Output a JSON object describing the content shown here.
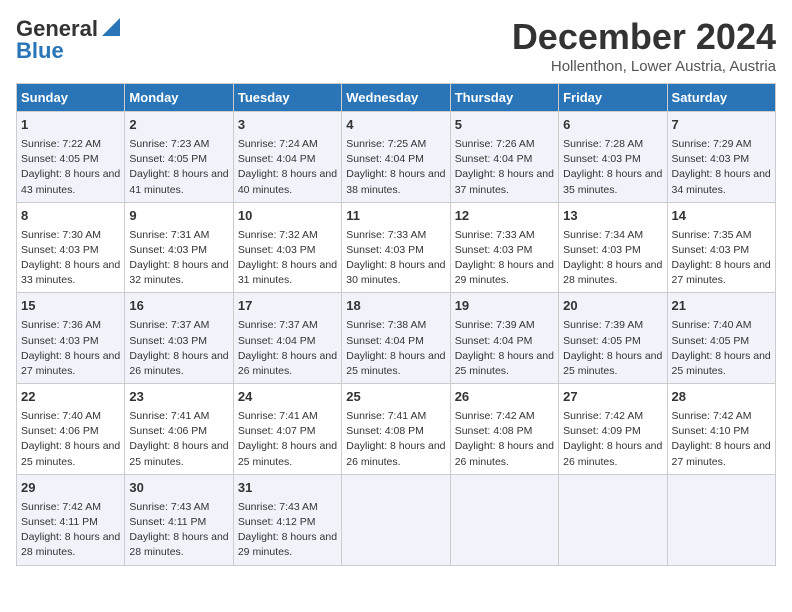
{
  "header": {
    "logo_general": "General",
    "logo_blue": "Blue",
    "month": "December 2024",
    "location": "Hollenthon, Lower Austria, Austria"
  },
  "weekdays": [
    "Sunday",
    "Monday",
    "Tuesday",
    "Wednesday",
    "Thursday",
    "Friday",
    "Saturday"
  ],
  "weeks": [
    [
      {
        "day": "1",
        "sunrise": "Sunrise: 7:22 AM",
        "sunset": "Sunset: 4:05 PM",
        "daylight": "Daylight: 8 hours and 43 minutes."
      },
      {
        "day": "2",
        "sunrise": "Sunrise: 7:23 AM",
        "sunset": "Sunset: 4:05 PM",
        "daylight": "Daylight: 8 hours and 41 minutes."
      },
      {
        "day": "3",
        "sunrise": "Sunrise: 7:24 AM",
        "sunset": "Sunset: 4:04 PM",
        "daylight": "Daylight: 8 hours and 40 minutes."
      },
      {
        "day": "4",
        "sunrise": "Sunrise: 7:25 AM",
        "sunset": "Sunset: 4:04 PM",
        "daylight": "Daylight: 8 hours and 38 minutes."
      },
      {
        "day": "5",
        "sunrise": "Sunrise: 7:26 AM",
        "sunset": "Sunset: 4:04 PM",
        "daylight": "Daylight: 8 hours and 37 minutes."
      },
      {
        "day": "6",
        "sunrise": "Sunrise: 7:28 AM",
        "sunset": "Sunset: 4:03 PM",
        "daylight": "Daylight: 8 hours and 35 minutes."
      },
      {
        "day": "7",
        "sunrise": "Sunrise: 7:29 AM",
        "sunset": "Sunset: 4:03 PM",
        "daylight": "Daylight: 8 hours and 34 minutes."
      }
    ],
    [
      {
        "day": "8",
        "sunrise": "Sunrise: 7:30 AM",
        "sunset": "Sunset: 4:03 PM",
        "daylight": "Daylight: 8 hours and 33 minutes."
      },
      {
        "day": "9",
        "sunrise": "Sunrise: 7:31 AM",
        "sunset": "Sunset: 4:03 PM",
        "daylight": "Daylight: 8 hours and 32 minutes."
      },
      {
        "day": "10",
        "sunrise": "Sunrise: 7:32 AM",
        "sunset": "Sunset: 4:03 PM",
        "daylight": "Daylight: 8 hours and 31 minutes."
      },
      {
        "day": "11",
        "sunrise": "Sunrise: 7:33 AM",
        "sunset": "Sunset: 4:03 PM",
        "daylight": "Daylight: 8 hours and 30 minutes."
      },
      {
        "day": "12",
        "sunrise": "Sunrise: 7:33 AM",
        "sunset": "Sunset: 4:03 PM",
        "daylight": "Daylight: 8 hours and 29 minutes."
      },
      {
        "day": "13",
        "sunrise": "Sunrise: 7:34 AM",
        "sunset": "Sunset: 4:03 PM",
        "daylight": "Daylight: 8 hours and 28 minutes."
      },
      {
        "day": "14",
        "sunrise": "Sunrise: 7:35 AM",
        "sunset": "Sunset: 4:03 PM",
        "daylight": "Daylight: 8 hours and 27 minutes."
      }
    ],
    [
      {
        "day": "15",
        "sunrise": "Sunrise: 7:36 AM",
        "sunset": "Sunset: 4:03 PM",
        "daylight": "Daylight: 8 hours and 27 minutes."
      },
      {
        "day": "16",
        "sunrise": "Sunrise: 7:37 AM",
        "sunset": "Sunset: 4:03 PM",
        "daylight": "Daylight: 8 hours and 26 minutes."
      },
      {
        "day": "17",
        "sunrise": "Sunrise: 7:37 AM",
        "sunset": "Sunset: 4:04 PM",
        "daylight": "Daylight: 8 hours and 26 minutes."
      },
      {
        "day": "18",
        "sunrise": "Sunrise: 7:38 AM",
        "sunset": "Sunset: 4:04 PM",
        "daylight": "Daylight: 8 hours and 25 minutes."
      },
      {
        "day": "19",
        "sunrise": "Sunrise: 7:39 AM",
        "sunset": "Sunset: 4:04 PM",
        "daylight": "Daylight: 8 hours and 25 minutes."
      },
      {
        "day": "20",
        "sunrise": "Sunrise: 7:39 AM",
        "sunset": "Sunset: 4:05 PM",
        "daylight": "Daylight: 8 hours and 25 minutes."
      },
      {
        "day": "21",
        "sunrise": "Sunrise: 7:40 AM",
        "sunset": "Sunset: 4:05 PM",
        "daylight": "Daylight: 8 hours and 25 minutes."
      }
    ],
    [
      {
        "day": "22",
        "sunrise": "Sunrise: 7:40 AM",
        "sunset": "Sunset: 4:06 PM",
        "daylight": "Daylight: 8 hours and 25 minutes."
      },
      {
        "day": "23",
        "sunrise": "Sunrise: 7:41 AM",
        "sunset": "Sunset: 4:06 PM",
        "daylight": "Daylight: 8 hours and 25 minutes."
      },
      {
        "day": "24",
        "sunrise": "Sunrise: 7:41 AM",
        "sunset": "Sunset: 4:07 PM",
        "daylight": "Daylight: 8 hours and 25 minutes."
      },
      {
        "day": "25",
        "sunrise": "Sunrise: 7:41 AM",
        "sunset": "Sunset: 4:08 PM",
        "daylight": "Daylight: 8 hours and 26 minutes."
      },
      {
        "day": "26",
        "sunrise": "Sunrise: 7:42 AM",
        "sunset": "Sunset: 4:08 PM",
        "daylight": "Daylight: 8 hours and 26 minutes."
      },
      {
        "day": "27",
        "sunrise": "Sunrise: 7:42 AM",
        "sunset": "Sunset: 4:09 PM",
        "daylight": "Daylight: 8 hours and 26 minutes."
      },
      {
        "day": "28",
        "sunrise": "Sunrise: 7:42 AM",
        "sunset": "Sunset: 4:10 PM",
        "daylight": "Daylight: 8 hours and 27 minutes."
      }
    ],
    [
      {
        "day": "29",
        "sunrise": "Sunrise: 7:42 AM",
        "sunset": "Sunset: 4:11 PM",
        "daylight": "Daylight: 8 hours and 28 minutes."
      },
      {
        "day": "30",
        "sunrise": "Sunrise: 7:43 AM",
        "sunset": "Sunset: 4:11 PM",
        "daylight": "Daylight: 8 hours and 28 minutes."
      },
      {
        "day": "31",
        "sunrise": "Sunrise: 7:43 AM",
        "sunset": "Sunset: 4:12 PM",
        "daylight": "Daylight: 8 hours and 29 minutes."
      },
      null,
      null,
      null,
      null
    ]
  ]
}
